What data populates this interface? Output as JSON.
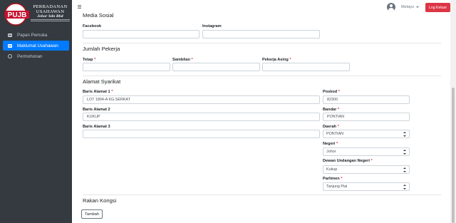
{
  "brand": {
    "logo_text": "PUJB",
    "line1": "PERBADANAN",
    "line2": "USAHAWAN",
    "line3": "Johor Sdn Bhd"
  },
  "sidebar": {
    "items": [
      {
        "label": "Papan Pemuka",
        "icon": "dashboard-icon"
      },
      {
        "label": "Maklumat Usahawan",
        "icon": "id-card-icon",
        "active": true
      },
      {
        "label": "Permohonan",
        "icon": "circle-icon"
      }
    ]
  },
  "topbar": {
    "language": "Melayu",
    "logout_label": "Log Keluar"
  },
  "sections": {
    "media_sosial": "Media Sosial",
    "jumlah_pekerja": "Jumlah Pekerja",
    "alamat_syarikat": "Alamat Syarikat",
    "rakan_kongsi": "Rakan Kongsi"
  },
  "social": {
    "facebook_label": "Facebook",
    "facebook_value": "",
    "instagram_label": "Instagram",
    "instagram_value": ""
  },
  "workers": {
    "tetap_label": "Tetap",
    "tetap_value": "",
    "sambilan_label": "Sambilan",
    "sambilan_value": "",
    "asing_label": "Pekerja Asing",
    "asing_value": ""
  },
  "address": {
    "line1_label": "Baris Alamat 1",
    "line1_value": "LOT 1894-A KG.SERKAT",
    "line2_label": "Baris Alamat 2",
    "line2_value": "KUKUP",
    "line3_label": "Baris Alamat 3",
    "line3_value": "",
    "poskod_label": "Poskod",
    "poskod_value": "82300",
    "bandar_label": "Bandar",
    "bandar_value": "PONTIAN",
    "daerah_label": "Daerah",
    "daerah_value": "PONTIAN",
    "negeri_label": "Negeri",
    "negeri_value": "Johor",
    "dun_label": "Dewan Undangan Negeri",
    "dun_value": "Kukup",
    "parlimen_label": "Parlimen",
    "parlimen_value": "Tanjung Piai"
  },
  "partners": {
    "add_label": "Tambah"
  },
  "colors": {
    "sidebar_bg": "#343a40",
    "active_nav": "#007bff",
    "logout_btn": "#dc3545",
    "required": "#dc3545"
  }
}
